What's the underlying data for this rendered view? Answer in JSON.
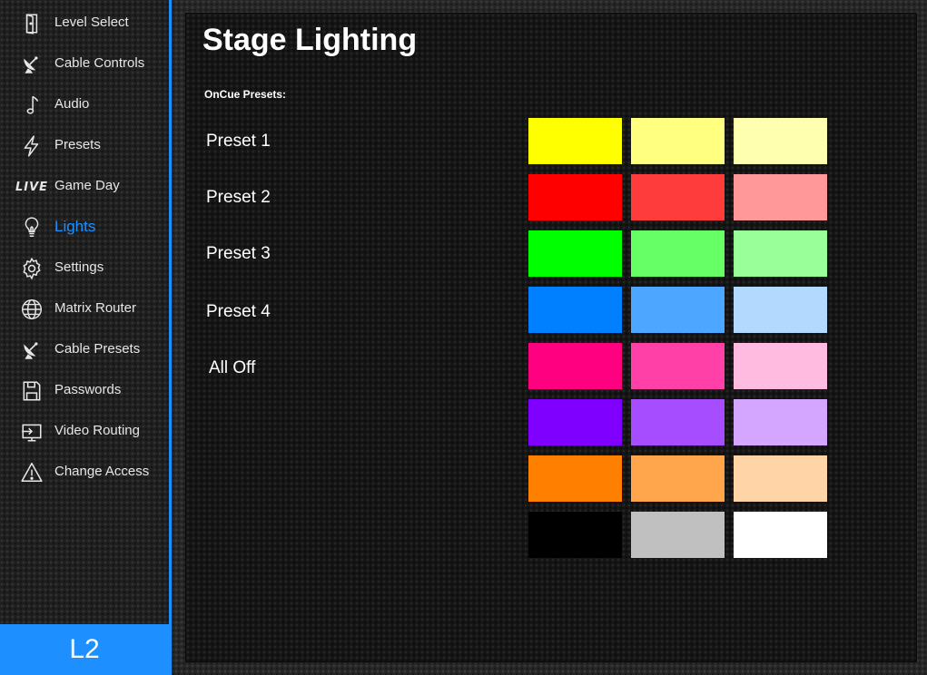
{
  "sidebar": {
    "items": [
      {
        "label": "Level Select",
        "icon": "door-icon"
      },
      {
        "label": "Cable Controls",
        "icon": "satellite-dish-icon"
      },
      {
        "label": "Audio",
        "icon": "music-note-icon"
      },
      {
        "label": "Presets",
        "icon": "lightning-icon"
      },
      {
        "label": "Game Day",
        "icon": "live-icon",
        "icon_text": "LIVE"
      },
      {
        "label": "Lights",
        "icon": "lightbulb-icon",
        "active": true
      },
      {
        "label": "Settings",
        "icon": "gear-icon"
      },
      {
        "label": "Matrix Router",
        "icon": "globe-icon"
      },
      {
        "label": "Cable Presets",
        "icon": "satellite-dish-icon"
      },
      {
        "label": "Passwords",
        "icon": "floppy-disk-icon"
      },
      {
        "label": "Video Routing",
        "icon": "monitor-input-icon"
      },
      {
        "label": "Change Access",
        "icon": "warning-icon"
      }
    ],
    "level": "L2",
    "accent_color": "#1e8fff"
  },
  "main": {
    "title": "Stage Lighting",
    "section_label": "OnCue Presets:",
    "presets": [
      "Preset 1",
      "Preset 2",
      "Preset 3",
      "Preset 4",
      "All Off"
    ],
    "swatches": [
      [
        "#ffff00",
        "#ffff80",
        "#ffffb0"
      ],
      [
        "#ff0000",
        "#ff3c3c",
        "#ff9999"
      ],
      [
        "#00ff00",
        "#66ff66",
        "#99ff99"
      ],
      [
        "#0080ff",
        "#4da6ff",
        "#b3d9ff"
      ],
      [
        "#ff0080",
        "#ff40a6",
        "#ffbbe0"
      ],
      [
        "#8000ff",
        "#a64dff",
        "#d4a6ff"
      ],
      [
        "#ff8000",
        "#ffa64d",
        "#ffd4a6"
      ],
      [
        "#000000",
        "#c0c0c0",
        "#ffffff"
      ]
    ]
  }
}
